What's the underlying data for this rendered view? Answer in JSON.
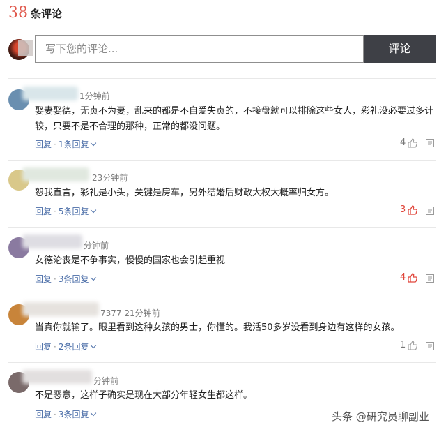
{
  "header": {
    "count": "38",
    "label": "条评论"
  },
  "composer": {
    "placeholder": "写下您的评论...",
    "submit_label": "评论"
  },
  "comments": [
    {
      "meta": "1分钟前",
      "text": "娶妻娶德，无贞不为妻，乱来的都是不自爱失贞的，不接盘就可以排除这些女人，彩礼没必要过多计较，只要不是不合理的那种，正常的都没问题。",
      "reply_label": "回复",
      "replies_label": "1条回复",
      "likes": "4",
      "liked": false
    },
    {
      "meta": "23分钟前",
      "text": "恕我直言，彩礼是小头，关键是房车，另外结婚后财政大权大概率归女方。",
      "reply_label": "回复",
      "replies_label": "5条回复",
      "likes": "3",
      "liked": true
    },
    {
      "meta": "分钟前",
      "text": "女德沦丧是不争事实，慢慢的国家也会引起重视",
      "reply_label": "回复",
      "replies_label": "3条回复",
      "likes": "4",
      "liked": true
    },
    {
      "meta": "7377 21分钟前",
      "text": "当真你就输了。眼里看到这种女孩的男士，你懂的。我活50多岁没看到身边有这样的女孩。",
      "reply_label": "回复",
      "replies_label": "2条回复",
      "likes": "1",
      "liked": false
    },
    {
      "meta": "分钟前",
      "text": "不是恶意，这样子确实是现在大部分年轻女生都这样。",
      "reply_label": "回复",
      "replies_label": "3条回复",
      "likes": "",
      "liked": false
    }
  ],
  "watermark": "头条 @研究员聊副业",
  "colors": {
    "accent_red": "#e0453a",
    "link_blue": "#4b6ea8",
    "button_dark": "#3e4046"
  }
}
